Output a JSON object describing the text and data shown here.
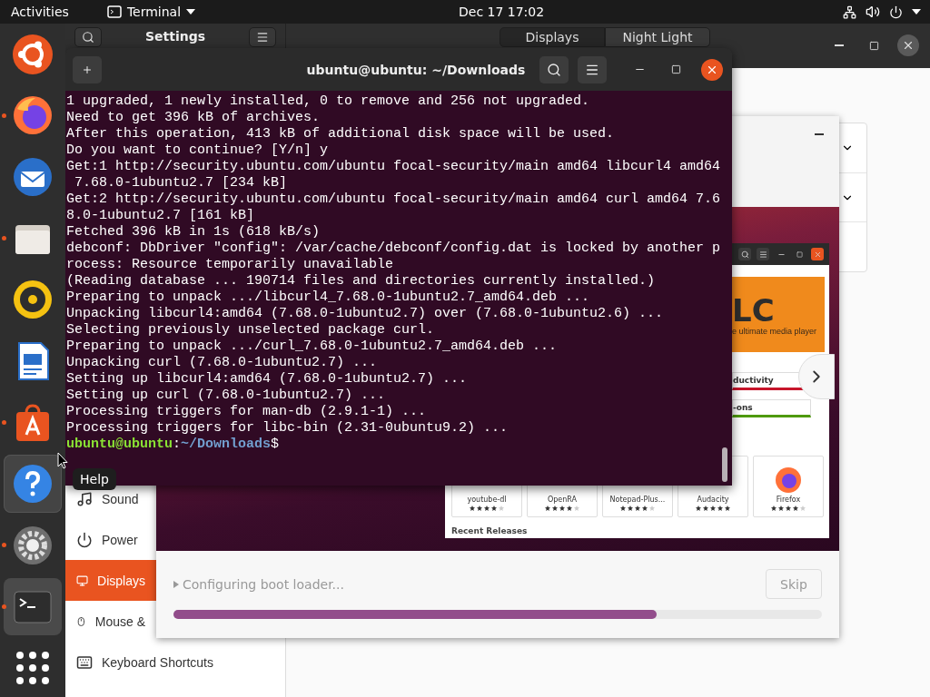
{
  "top_bar": {
    "activities": "Activities",
    "app_menu": "Terminal",
    "clock": "Dec 17 17:02"
  },
  "dock": {
    "items": [
      {
        "kind": "ubuntu",
        "running": false,
        "selected": false,
        "hovered": false
      },
      {
        "kind": "firefox",
        "running": true,
        "selected": false,
        "hovered": false
      },
      {
        "kind": "mail",
        "running": false,
        "selected": false,
        "hovered": false
      },
      {
        "kind": "files",
        "running": true,
        "selected": false,
        "hovered": false
      },
      {
        "kind": "music",
        "running": false,
        "selected": false,
        "hovered": false
      },
      {
        "kind": "writer",
        "running": false,
        "selected": false,
        "hovered": false
      },
      {
        "kind": "software",
        "running": true,
        "selected": false,
        "hovered": false
      },
      {
        "kind": "help",
        "running": false,
        "selected": false,
        "hovered": true
      },
      {
        "kind": "settings",
        "running": true,
        "selected": false,
        "hovered": false
      },
      {
        "kind": "terminal",
        "running": true,
        "selected": true,
        "hovered": false
      },
      {
        "kind": "apps",
        "running": false,
        "selected": false,
        "hovered": false
      }
    ]
  },
  "tooltip": "Help",
  "settings": {
    "title": "Settings",
    "tabs": [
      {
        "label": "Displays",
        "selected": true
      },
      {
        "label": "Night Light",
        "selected": false
      }
    ],
    "sidebar": [
      {
        "kind": "sound",
        "label": "Sound",
        "selected": false
      },
      {
        "kind": "power",
        "label": "Power",
        "selected": false
      },
      {
        "kind": "displays",
        "label": "Displays",
        "selected": true
      },
      {
        "kind": "mouse",
        "label": "Mouse &",
        "selected": false
      },
      {
        "kind": "keyboard",
        "label": "Keyboard Shortcuts",
        "selected": false
      }
    ]
  },
  "installer": {
    "status": "Configuring boot loader...",
    "skip": "Skip",
    "progress": {
      "level": 0.745
    },
    "software_preview": {
      "banner_title": "LC",
      "banner_subtitle": "e ultimate media player",
      "categories": [
        {
          "label": "ductivity",
          "color": "#c7162b"
        },
        {
          "label": "-ons",
          "color": "#4e9a06"
        }
      ],
      "apps": [
        {
          "name": "youtube-dl",
          "stars": 4
        },
        {
          "name": "OpenRA",
          "stars": 4
        },
        {
          "name": "Notepad-Plus...",
          "stars": 4
        },
        {
          "name": "Audacity",
          "stars": 5
        },
        {
          "name": "Firefox",
          "stars": 4
        }
      ],
      "section": "Recent Releases"
    }
  },
  "terminal": {
    "title": "ubuntu@ubuntu: ~/Downloads",
    "lines": [
      "1 upgraded, 1 newly installed, 0 to remove and 256 not upgraded.",
      "Need to get 396 kB of archives.",
      "After this operation, 413 kB of additional disk space will be used.",
      "Do you want to continue? [Y/n] y",
      "Get:1 http://security.ubuntu.com/ubuntu focal-security/main amd64 libcurl4 amd64",
      " 7.68.0-1ubuntu2.7 [234 kB]",
      "Get:2 http://security.ubuntu.com/ubuntu focal-security/main amd64 curl amd64 7.6",
      "8.0-1ubuntu2.7 [161 kB]",
      "Fetched 396 kB in 1s (618 kB/s)",
      "debconf: DbDriver \"config\": /var/cache/debconf/config.dat is locked by another p",
      "rocess: Resource temporarily unavailable",
      "(Reading database ... 190714 files and directories currently installed.)",
      "Preparing to unpack .../libcurl4_7.68.0-1ubuntu2.7_amd64.deb ...",
      "Unpacking libcurl4:amd64 (7.68.0-1ubuntu2.7) over (7.68.0-1ubuntu2.6) ...",
      "Selecting previously unselected package curl.",
      "Preparing to unpack .../curl_7.68.0-1ubuntu2.7_amd64.deb ...",
      "Unpacking curl (7.68.0-1ubuntu2.7) ...",
      "Setting up libcurl4:amd64 (7.68.0-1ubuntu2.7) ...",
      "Setting up curl (7.68.0-1ubuntu2.7) ...",
      "Processing triggers for man-db (2.9.1-1) ...",
      "Processing triggers for libc-bin (2.31-0ubuntu9.2) ..."
    ],
    "prompt": [
      {
        "kind": "user",
        "text": "ubuntu@ubuntu"
      },
      {
        "kind": "plain",
        "text": ":"
      },
      {
        "kind": "path",
        "text": "~/Downloads"
      },
      {
        "kind": "plain",
        "text": "$"
      }
    ]
  }
}
